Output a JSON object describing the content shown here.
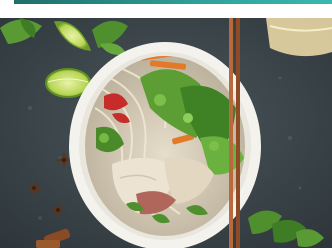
{
  "photo": {
    "subject": "noodle-soup-bowl",
    "colors": {
      "table": "#3f4a50",
      "bowl": "#f4f2ec",
      "broth": "#d9d2c4",
      "herbs": "#4f8f2e",
      "carrot": "#e27a2a",
      "pepper": "#c62c2a",
      "lime": "#b6d34f",
      "chopsticks": "#a0522d",
      "accent": "#2fa39a"
    }
  }
}
